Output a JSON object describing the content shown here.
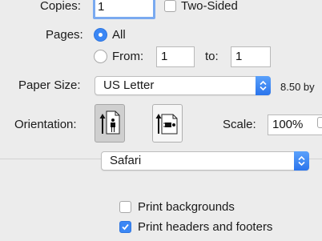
{
  "copies": {
    "label": "Copies:",
    "value": "1"
  },
  "two_sided": {
    "label": "Two-Sided",
    "checked": false
  },
  "pages": {
    "label": "Pages:",
    "all_label": "All",
    "from_label": "From:",
    "from_value": "1",
    "to_label": "to:",
    "to_value": "1",
    "selected": "all"
  },
  "paper_size": {
    "label": "Paper Size:",
    "value": "US Letter",
    "dimension_text": "8.50 by"
  },
  "orientation": {
    "label": "Orientation:",
    "selected": "portrait"
  },
  "scale": {
    "label": "Scale:",
    "value": "100%"
  },
  "app_section": {
    "value": "Safari"
  },
  "options": {
    "print_backgrounds": {
      "label": "Print backgrounds",
      "checked": false
    },
    "print_headers_footers": {
      "label": "Print headers and footers",
      "checked": true
    }
  },
  "colors": {
    "accent": "#3b87f5",
    "focus_ring": "#7aaaf0",
    "background": "#ececec"
  }
}
